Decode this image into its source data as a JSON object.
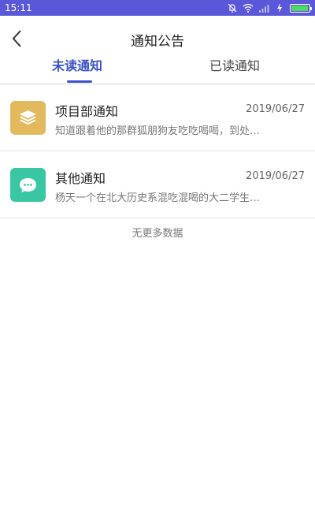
{
  "status_bar": {
    "time": "15:11",
    "battery_level": 0.95,
    "icons": [
      "bell-off-icon",
      "wifi-icon",
      "signal-icon",
      "charging-icon",
      "battery-icon"
    ]
  },
  "header": {
    "title": "通知公告",
    "back_icon": "chevron-left-icon"
  },
  "tabs": [
    {
      "label": "未读通知",
      "active": true
    },
    {
      "label": "已读通知",
      "active": false
    }
  ],
  "notifications": [
    {
      "title": "项目部通知",
      "date": "2019/06/27",
      "snippet": "知道跟着他的那群狐朋狗友吃吃喝喝，到处…",
      "icon": "layers-icon",
      "icon_bg": "#e3b95e"
    },
    {
      "title": "其他通知",
      "date": "2019/06/27",
      "snippet": "杨天一个在北大历史系混吃混喝的大二学生…",
      "icon": "chat-bubble-icon",
      "icon_bg": "#39c6a2"
    }
  ],
  "footer_text": "无更多数据",
  "colors": {
    "status_bar": "#5b57d9",
    "accent": "#3b51c8"
  }
}
